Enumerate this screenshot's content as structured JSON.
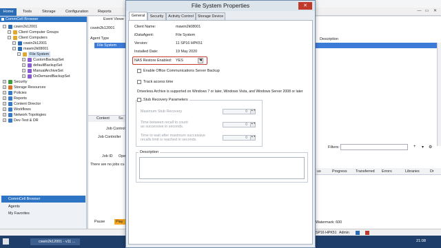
{
  "menu": {
    "home": "Home",
    "tools": "Tools",
    "storage": "Storage",
    "configuration": "Configuration",
    "reports": "Reports"
  },
  "browser_title": "CommCell Browser",
  "tree": [
    {
      "label": "cswin2k12001",
      "depth": 0
    },
    {
      "label": "Client Computer Groups",
      "depth": 1
    },
    {
      "label": "Client Computers",
      "depth": 1
    },
    {
      "label": "cswin2k12001",
      "depth": 2
    },
    {
      "label": "mawin2k08001",
      "depth": 2
    },
    {
      "label": "File System",
      "depth": 3
    },
    {
      "label": "CustomBackupSet",
      "depth": 4
    },
    {
      "label": "defaultBackupSet",
      "depth": 4
    },
    {
      "label": "ManualArchiveSet",
      "depth": 4
    },
    {
      "label": "OnDemandBackupSet",
      "depth": 4
    },
    {
      "label": "Security",
      "depth": 0
    },
    {
      "label": "Storage Resources",
      "depth": 0
    },
    {
      "label": "Policies",
      "depth": 0
    },
    {
      "label": "Reports",
      "depth": 0
    },
    {
      "label": "Content Director",
      "depth": 0
    },
    {
      "label": "Workflows",
      "depth": 0
    },
    {
      "label": "Network Topologies",
      "depth": 0
    },
    {
      "label": "Dev-Test & DR",
      "depth": 0
    }
  ],
  "bottom_nav": [
    "CommCell Browser",
    "Agents",
    "My Favorites"
  ],
  "middle": {
    "breadcrumb": "cswin2k12001",
    "event_viewer": "Event Viewe",
    "agent_type_header": "Agent Type",
    "selected_row": "File System",
    "content_tab": "Content",
    "su_tab": "Su",
    "job_control_tab": "Job Control",
    "job_controller": "Job Controller",
    "job_id_header": "Job ID",
    "ope_header": "Ope",
    "no_jobs_text": "There are no jobs cu",
    "pause": "Pause",
    "play": "Play"
  },
  "right": {
    "description_header": "Description",
    "filters": "Filters:",
    "columns": [
      "us",
      "Progress",
      "Transferred",
      "Errors",
      "Libraries",
      "Dr"
    ],
    "watermark": "Watermark: 600",
    "version": "SP16 HPK51",
    "user": "Admin"
  },
  "taskbar": {
    "app": "cswin2k12001 - v11 ...",
    "time": "21:08"
  },
  "dialog": {
    "title": "File System Properties",
    "close": "✕",
    "tabs": [
      "General",
      "Security",
      "Activity Control",
      "Storage Device"
    ],
    "client_name_label": "Client Name:",
    "client_name": "mawin2k08001",
    "idataagent_label": "iDataAgent:",
    "idataagent": "File System",
    "version_label": "Version:",
    "version": "11 SP16 HPK51",
    "installed_date_label": "Installed Date:",
    "installed_date": "19 May 2020",
    "nas_label": "NAS Restore Enabled:",
    "nas_value": "YES",
    "office_comm": "Enable Office Communications Server Backup",
    "track_access": "Track access time",
    "driverless_note": "Driverless Archive is supported on Windows 7 or later, Windows Vista, and Windows Server 2008 or later",
    "stub_group": "Stub Recovery Parameters",
    "max_stub": "Maximum Stub Recovery",
    "time_recall_1": "Time between recall to count",
    "time_recall_2": "as successive in seconds.",
    "wait_1": "Time to wait after maximum successive",
    "wait_2": "recalls limit is reached in seconds.",
    "spin_values": [
      "0",
      "0",
      "0"
    ],
    "description_label": "Description"
  },
  "colors": {
    "accent": "#2b6cb5",
    "highlight_red": "#c0392b",
    "selection": "#3d7bd8"
  }
}
